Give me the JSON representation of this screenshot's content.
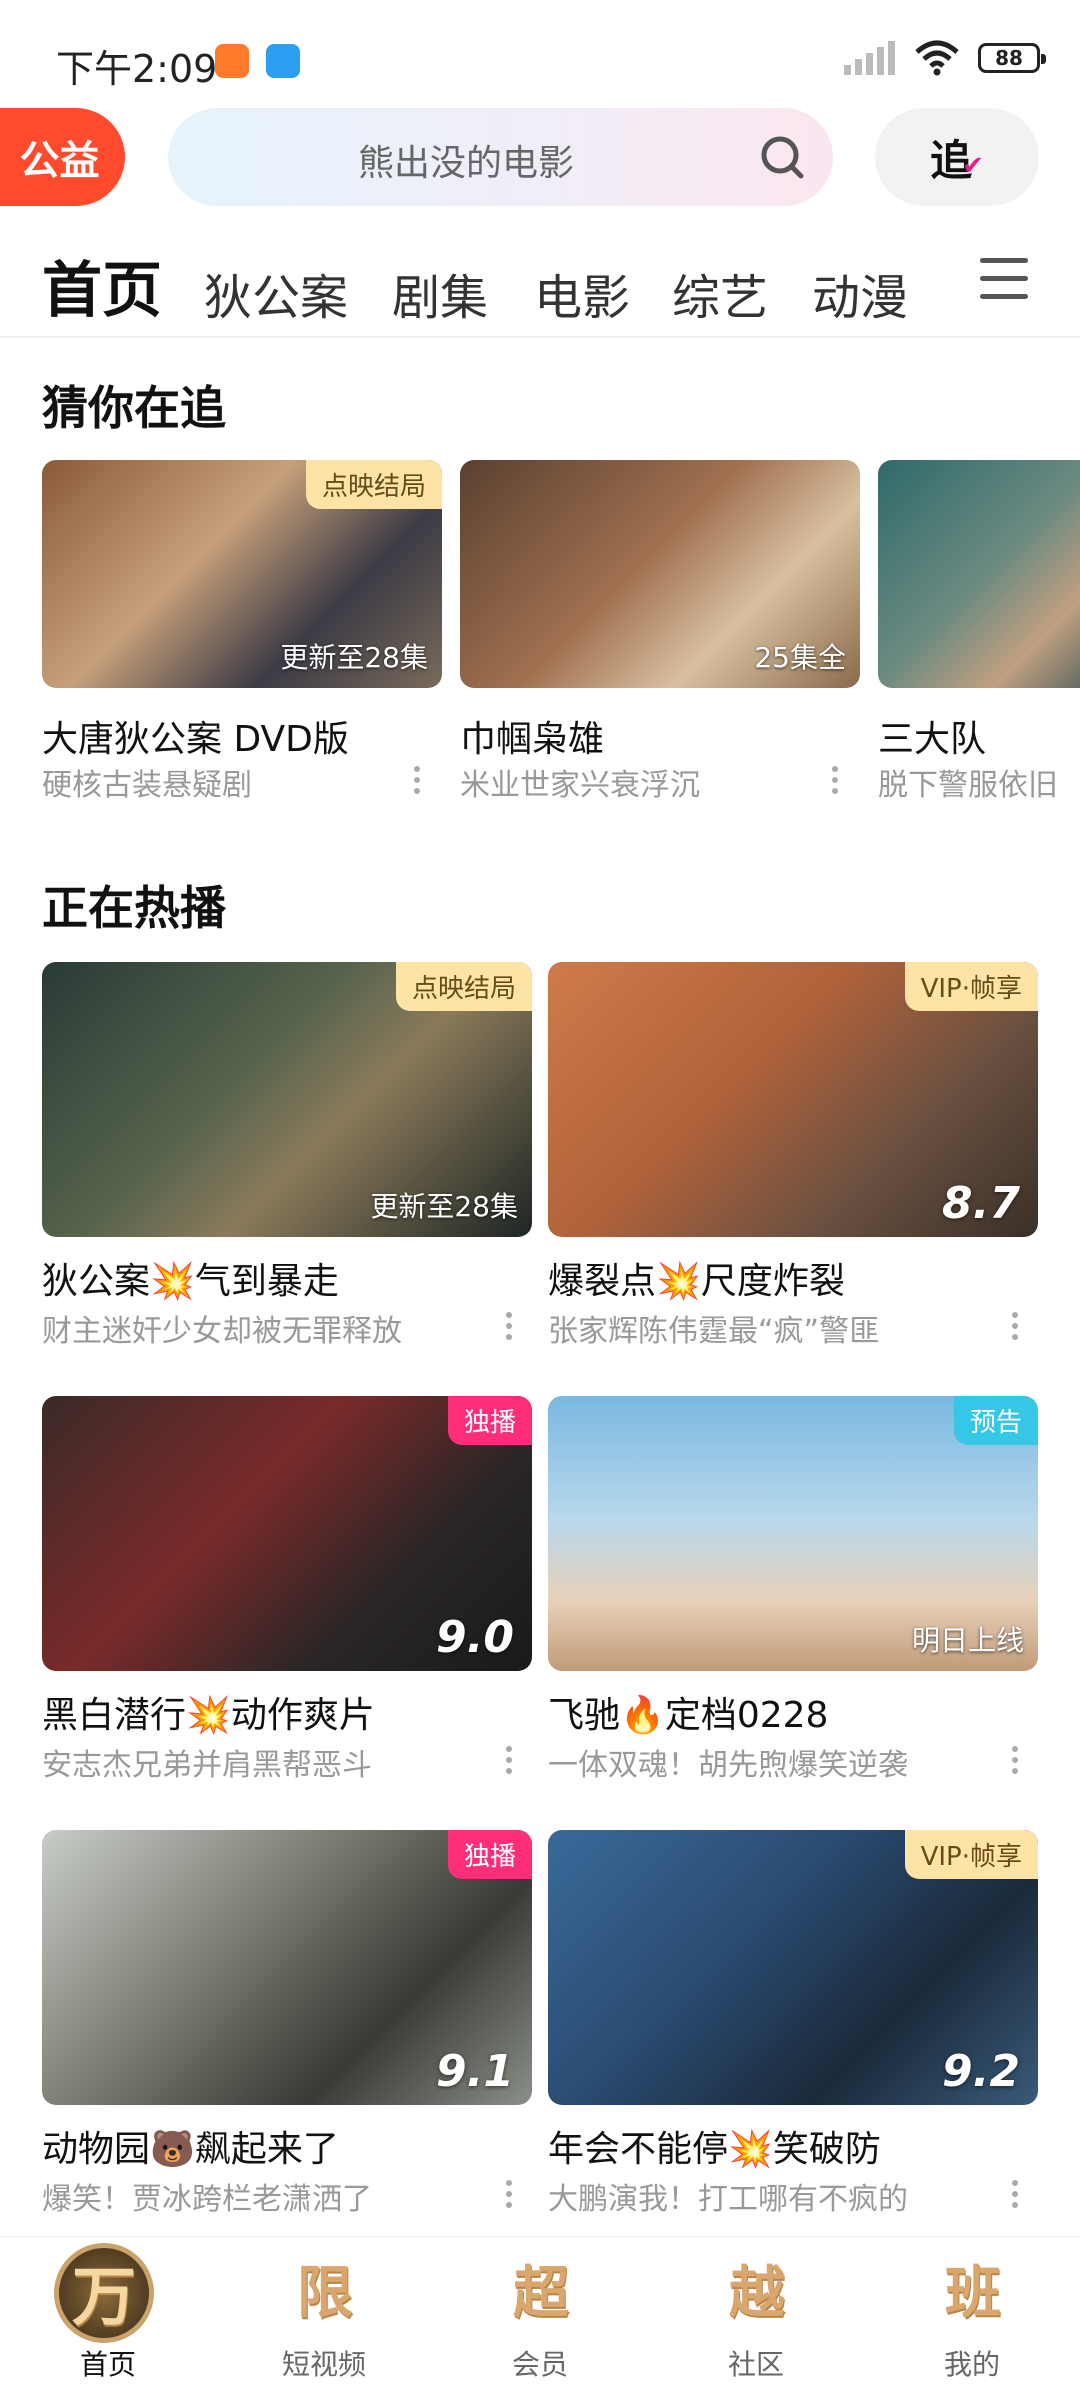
{
  "status": {
    "time": "下午2:09",
    "battery": "88"
  },
  "header": {
    "charity_label": "公益",
    "search_placeholder": "熊出没的电影",
    "follow_label": "追"
  },
  "tabs": [
    "首页",
    "狄公案",
    "剧集",
    "电影",
    "综艺",
    "动漫"
  ],
  "guess": {
    "title": "猜你在追",
    "items": [
      {
        "title": "大唐狄公案 DVD版",
        "subtitle": "硬核古装悬疑剧",
        "badge": "点映结局",
        "overlay": "更新至28集"
      },
      {
        "title": "巾帼枭雄",
        "subtitle": "米业世家兴衰浮沉",
        "badge": "",
        "overlay": "25集全"
      },
      {
        "title": "三大队",
        "subtitle": "脱下警服依旧",
        "badge": "",
        "overlay": ""
      }
    ]
  },
  "hot": {
    "title": "正在热播",
    "items": [
      {
        "title": "狄公案💥气到暴走",
        "subtitle": "财主迷奸少女却被无罪释放",
        "badge": "点映结局",
        "overlay": "更新至28集",
        "score": "",
        "badge_color": "#fde3a6"
      },
      {
        "title": "爆裂点💥尺度炸裂",
        "subtitle": "张家辉陈伟霆最“疯”警匪",
        "badge": "VIP·帧享",
        "overlay": "",
        "score": "8.7",
        "badge_color": "#fde3a6"
      },
      {
        "title": "黑白潜行💥动作爽片",
        "subtitle": "安志杰兄弟并肩黑帮恶斗",
        "badge": "独播",
        "overlay": "",
        "score": "9.0",
        "badge_color": "#ff2d7a"
      },
      {
        "title": "飞驰🔥定档0228",
        "subtitle": "一体双魂！胡先煦爆笑逆袭",
        "badge": "预告",
        "overlay": "明日上线",
        "score": "",
        "badge_color": "#36c6e6"
      },
      {
        "title": "动物园🐻飙起来了",
        "subtitle": "爆笑！贾冰跨栏老潇洒了",
        "badge": "独播",
        "overlay": "",
        "score": "9.1",
        "badge_color": "#ff2d7a"
      },
      {
        "title": "年会不能停💥笑破防",
        "subtitle": "大鹏演我！打工哪有不疯的",
        "badge": "VIP·帧享",
        "overlay": "",
        "score": "9.2",
        "badge_color": "#fde3a6"
      }
    ]
  },
  "bottom_nav": [
    {
      "icon": "万",
      "label": "首页"
    },
    {
      "icon": "限",
      "label": "短视频"
    },
    {
      "icon": "超",
      "label": "会员"
    },
    {
      "icon": "越",
      "label": "社区"
    },
    {
      "icon": "班",
      "label": "我的"
    }
  ]
}
